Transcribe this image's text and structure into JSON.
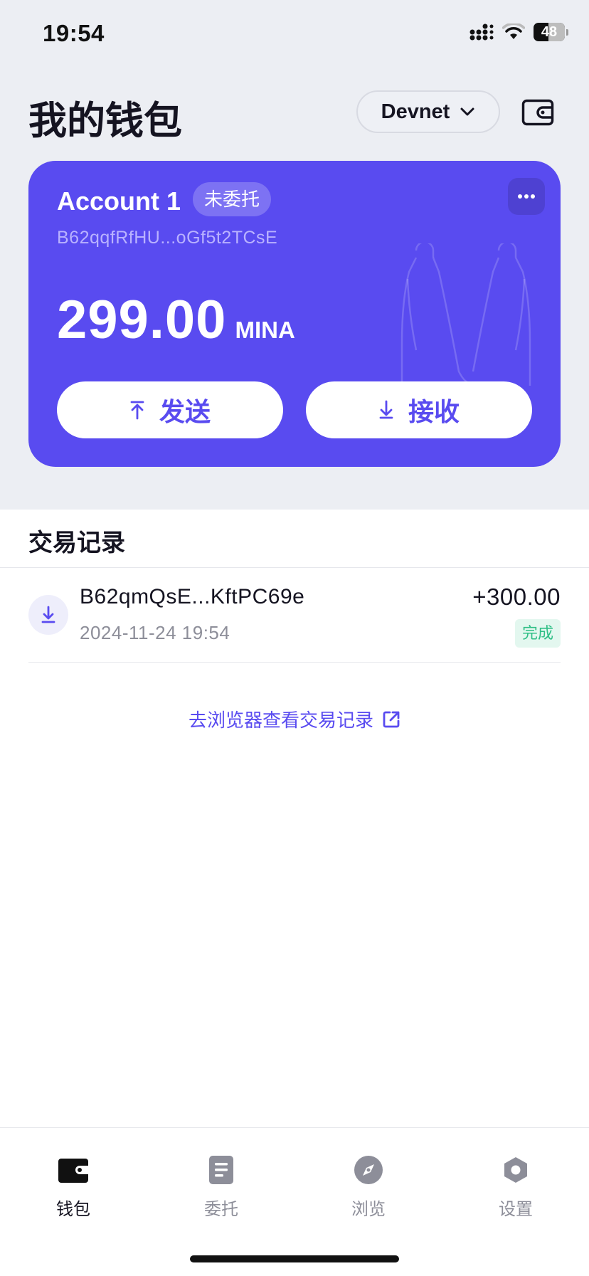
{
  "status_bar": {
    "time": "19:54",
    "battery": "48",
    "battery_level": 0.48
  },
  "header": {
    "title": "我的钱包",
    "network": "Devnet"
  },
  "account": {
    "name": "Account 1",
    "stake_status": "未委托",
    "address": "B62qqfRfHU...oGf5t2TCsE",
    "balance": "299.00",
    "unit": "MINA",
    "send_label": "发送",
    "receive_label": "接收"
  },
  "transactions": {
    "header": "交易记录",
    "items": [
      {
        "address": "B62qmQsE...KftPC69e",
        "time": "2024-11-24 19:54",
        "amount": "+300.00",
        "status": "完成",
        "direction": "receive"
      }
    ],
    "explorer_link": "去浏览器查看交易记录"
  },
  "tabbar": {
    "items": [
      {
        "label": "钱包",
        "icon": "wallet-icon",
        "active": true
      },
      {
        "label": "委托",
        "icon": "document-icon",
        "active": false
      },
      {
        "label": "浏览",
        "icon": "compass-icon",
        "active": false
      },
      {
        "label": "设置",
        "icon": "gear-icon",
        "active": false
      }
    ]
  },
  "colors": {
    "accent": "#594bf0",
    "success": "#2fbf86",
    "background": "#eceef3"
  }
}
